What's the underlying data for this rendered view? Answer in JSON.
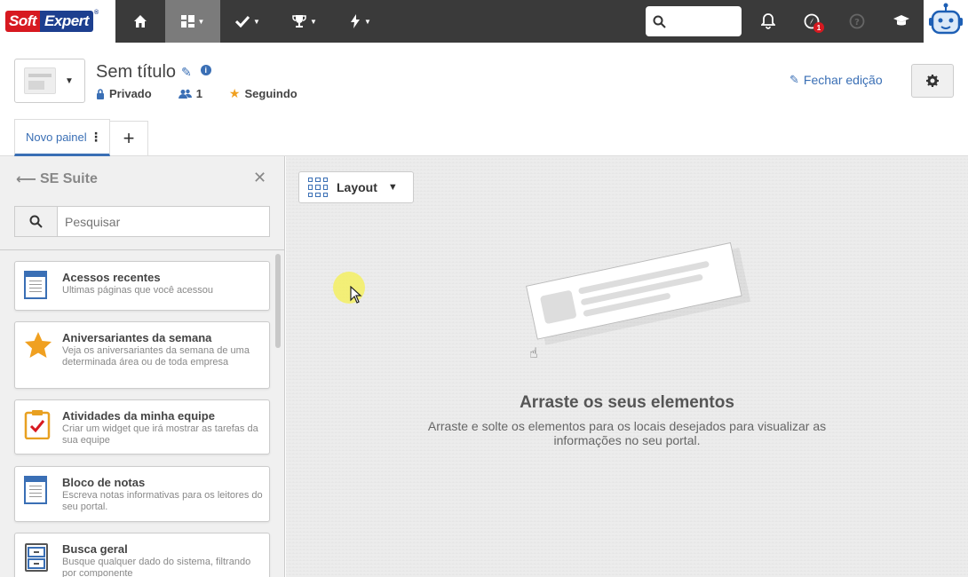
{
  "brand": {
    "soft": "Soft",
    "expert": "Expert",
    "reg": "®"
  },
  "nav": {
    "items": [
      {
        "icon": "home-icon"
      },
      {
        "icon": "dashboard-icon"
      },
      {
        "icon": "check-icon"
      },
      {
        "icon": "trophy-icon"
      },
      {
        "icon": "bolt-icon"
      }
    ],
    "notifications_badge": "1"
  },
  "portal": {
    "title": "Sem título",
    "privacy": "Privado",
    "members": "1",
    "follow": "Seguindo",
    "close_edit": "Fechar edição"
  },
  "tabs": [
    {
      "label": "Novo painel"
    }
  ],
  "sidebar": {
    "title": "SE Suite",
    "search_placeholder": "Pesquisar",
    "widgets": [
      {
        "title": "Acessos recentes",
        "desc": "Ultimas páginas que você acessou",
        "icon": "document-icon"
      },
      {
        "title": "Aniversariantes da semana",
        "desc": "Veja os aniversariantes da semana de uma determinada área ou de toda empresa",
        "icon": "star-icon"
      },
      {
        "title": "Atividades da minha equipe",
        "desc": "Criar um widget que irá mostrar as tarefas da sua equipe",
        "icon": "clipboard-check-icon"
      },
      {
        "title": "Bloco de notas",
        "desc": "Escreva notas informativas para os leitores do seu portal.",
        "icon": "notepad-icon"
      },
      {
        "title": "Busca geral",
        "desc": "Busque qualquer dado do sistema, filtrando por componente",
        "icon": "cabinet-icon"
      }
    ]
  },
  "canvas": {
    "layout_label": "Layout",
    "empty_title": "Arraste os seus elementos",
    "empty_desc": "Arraste e solte os elementos para os locais desejados para visualizar as informações no seu portal."
  },
  "colors": {
    "accent": "#3a6fb5",
    "topbar": "#3a3a3a",
    "star": "#f0a020",
    "badge": "#d71920"
  }
}
